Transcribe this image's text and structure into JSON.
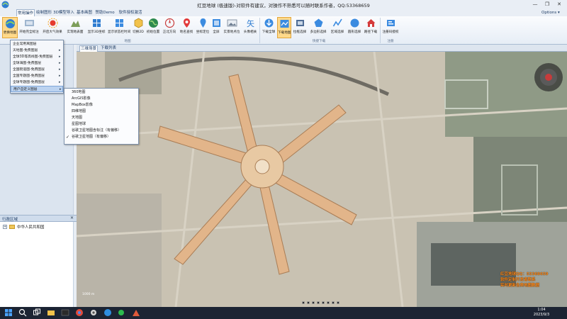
{
  "window": {
    "title": "红豆地球 (极速版)-对软件有建议，对操作不熟悉可以随时联系作者，QQ:53368659",
    "min": "—",
    "max": "❐",
    "close": "✕"
  },
  "menu": {
    "tabs": [
      "常用操作",
      "绘制图形",
      "3D模型导入",
      "基本画图",
      "赞助Demo",
      "软件授权激活"
    ],
    "options": "Options ▾"
  },
  "ribbon": {
    "buttons": [
      "更换地图",
      "开始完全标注",
      "开启大气效果",
      "实现地表面",
      "显示3D坐标",
      "显示状态栏时间",
      "切换2D",
      "初始位置",
      "正北方向",
      "地名查找",
      "坐标定位",
      "全屏",
      "实景地点位",
      "头像相关",
      "下载全球",
      "下载地图",
      "拉框选择",
      "多边形选择",
      "区域选择",
      "圆形选择",
      "路径下载",
      "注册码授权"
    ],
    "groups": [
      "地图",
      "快捷下载",
      "注册"
    ]
  },
  "layer_menu": {
    "items": [
      "企业常用离图层",
      "天地图-免费图层",
      "全球3D等高线图-免费图层",
      "全球海图-免费图层",
      "全国街道图-免费图层",
      "全国专题图-免费图层",
      "全球专题图-免费图层",
      "用户自定义图层"
    ]
  },
  "sub_menu": {
    "items": [
      "360地图",
      "ArcGIS影像",
      "MapBox影像",
      "四维地图",
      "天地图",
      "星图地球",
      "谷歌卫星地图含标注（有偏移）",
      "谷歌卫星地图（有偏移）"
    ],
    "checked_index": 7,
    "check_mark": "✓"
  },
  "admin_panel": {
    "title": "行政区域",
    "close": "✕",
    "tree": {
      "expander": "+",
      "root": "中华人民共和国"
    }
  },
  "map_tabs": [
    "三维场景",
    "下载列表"
  ],
  "watermark": {
    "lines": [
      "红豆地球QQ：53368659",
      "软件定制开发者联系",
      "实时更新各类地图数据"
    ]
  },
  "scale": "1000 m",
  "taskbar": {
    "time": "1:04",
    "date": "2023/9/3"
  },
  "colors": {
    "accent": "#2b5797",
    "ribbon_selected": "#ffd98a",
    "watermark": "#ff8a1a"
  }
}
